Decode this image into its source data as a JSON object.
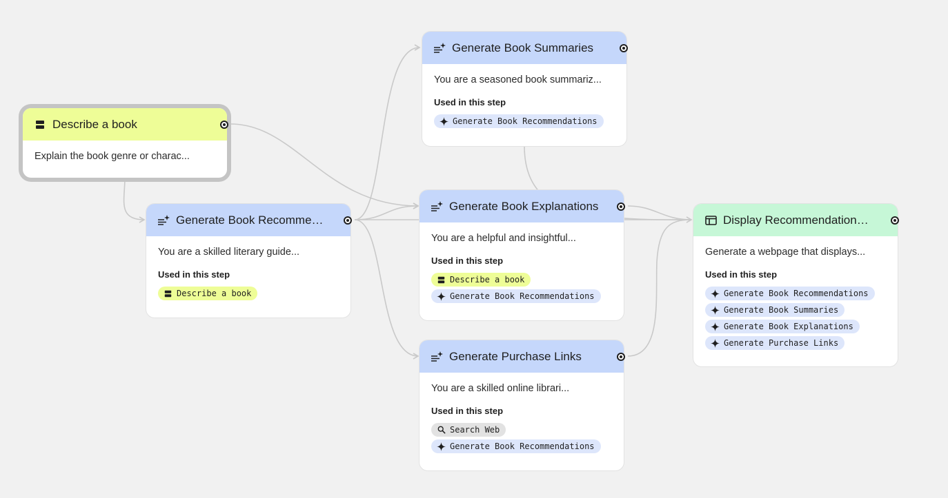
{
  "nodes": {
    "describe": {
      "title": "Describe a book",
      "icon": "input-icon",
      "description": "Explain the book genre or charac..."
    },
    "recommendations": {
      "title": "Generate Book Recommendations",
      "icon": "generate-text-icon",
      "description": "You are a skilled literary guide...",
      "used_label": "Used in this step",
      "chips": [
        {
          "label": "Describe a book",
          "icon": "input-icon",
          "color": "yellow"
        }
      ]
    },
    "summaries": {
      "title": "Generate Book Summaries",
      "icon": "generate-text-icon",
      "description": "You are a seasoned book summariz...",
      "used_label": "Used in this step",
      "chips": [
        {
          "label": "Generate Book Recommendations",
          "icon": "spark-icon",
          "color": "blue"
        }
      ]
    },
    "explanations": {
      "title": "Generate Book Explanations",
      "icon": "generate-text-icon",
      "description": "You are a helpful and insightful...",
      "used_label": "Used in this step",
      "chips": [
        {
          "label": "Describe a book",
          "icon": "input-icon",
          "color": "yellow"
        },
        {
          "label": "Generate Book Recommendations",
          "icon": "spark-icon",
          "color": "blue"
        }
      ]
    },
    "purchase": {
      "title": "Generate Purchase Links",
      "icon": "generate-text-icon",
      "description": "You are a skilled online librari...",
      "used_label": "Used in this step",
      "chips": [
        {
          "label": "Search Web",
          "icon": "search-icon",
          "color": "grey"
        },
        {
          "label": "Generate Book Recommendations",
          "icon": "spark-icon",
          "color": "blue"
        }
      ]
    },
    "display": {
      "title": "Display Recommendations Page",
      "icon": "web-page-icon",
      "description": "Generate a webpage that displays...",
      "used_label": "Used in this step",
      "chips": [
        {
          "label": "Generate Book Recommendations",
          "icon": "spark-icon",
          "color": "blue"
        },
        {
          "label": "Generate Book Summaries",
          "icon": "spark-icon",
          "color": "blue"
        },
        {
          "label": "Generate Book Explanations",
          "icon": "spark-icon",
          "color": "blue"
        },
        {
          "label": "Generate Purchase Links",
          "icon": "spark-icon",
          "color": "blue"
        }
      ]
    }
  },
  "colors": {
    "canvas": "#f1f1f1",
    "input_header": "#eefd97",
    "generate_header": "#c5d7fb",
    "output_header": "#c6f7d7",
    "edge": "#c9c9c9",
    "chip_blue": "#dde6fb",
    "chip_yellow": "#eefd97",
    "chip_grey": "#e2e2e2"
  }
}
